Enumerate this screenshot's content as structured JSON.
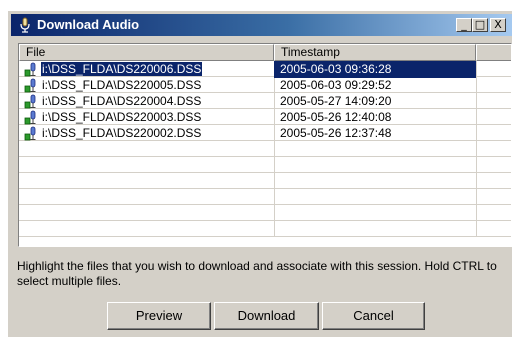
{
  "window": {
    "title": "Download Audio",
    "title_icon": "microphone-icon",
    "controls": {
      "minimize": "_",
      "maximize": "□",
      "close": "X"
    }
  },
  "list": {
    "columns": [
      "File",
      "Timestamp",
      ""
    ],
    "rows": [
      {
        "file": "i:\\DSS_FLDA\\DS220006.DSS",
        "timestamp": "2005-06-03 09:36:28",
        "selected": true,
        "icon": "dss-audio-file-icon"
      },
      {
        "file": "i:\\DSS_FLDA\\DS220005.DSS",
        "timestamp": "2005-06-03 09:29:52",
        "selected": false,
        "icon": "dss-audio-file-icon"
      },
      {
        "file": "i:\\DSS_FLDA\\DS220004.DSS",
        "timestamp": "2005-05-27 14:09:20",
        "selected": false,
        "icon": "dss-audio-file-icon"
      },
      {
        "file": "i:\\DSS_FLDA\\DS220003.DSS",
        "timestamp": "2005-05-26 12:40:08",
        "selected": false,
        "icon": "dss-audio-file-icon"
      },
      {
        "file": "i:\\DSS_FLDA\\DS220002.DSS",
        "timestamp": "2005-05-26 12:37:48",
        "selected": false,
        "icon": "dss-audio-file-icon"
      }
    ],
    "selection_color": "#0a246a"
  },
  "instructions": "Highlight the files that you wish to download and associate with this session.  Hold CTRL to select multiple files.",
  "buttons": {
    "preview": "Preview",
    "download": "Download",
    "cancel": "Cancel"
  },
  "colors": {
    "title_bar_start": "#0a246a",
    "title_bar_end": "#a6caf0",
    "face": "#d4d0c8"
  }
}
